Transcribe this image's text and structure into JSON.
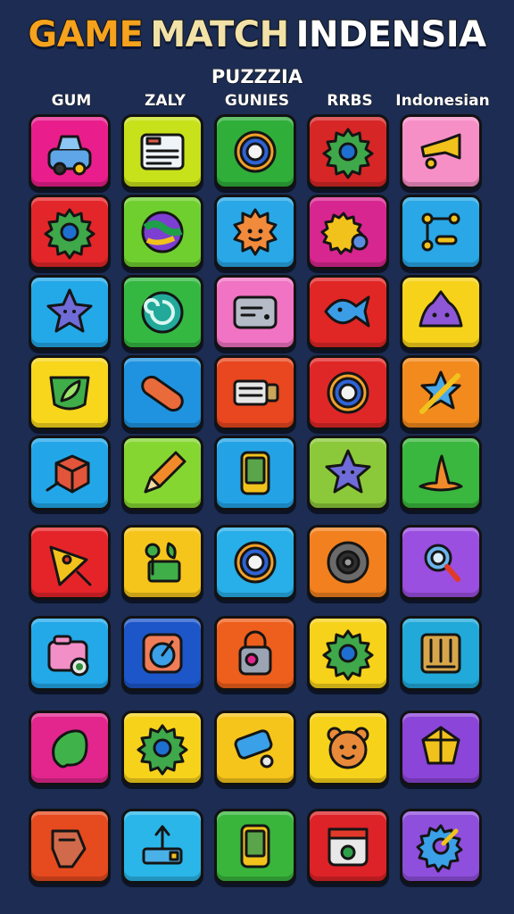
{
  "title": {
    "part1": "GAME",
    "part2": "MATCH",
    "part3": "INDENSIA"
  },
  "subtitle": "PUZZZIA",
  "columns": [
    "GUM",
    "ZALY",
    "GUNIES",
    "RRBS",
    "Indonesian"
  ],
  "tiles": [
    [
      {
        "color": "#e91e8c",
        "icon": "car-icon"
      },
      {
        "color": "#c7e21a",
        "icon": "id-card-icon"
      },
      {
        "color": "#2fae3a",
        "icon": "ring-icon"
      },
      {
        "color": "#d62626",
        "icon": "gear-icon"
      },
      {
        "color": "#f78fc7",
        "icon": "trumpet-icon"
      }
    ],
    [
      {
        "color": "#e3262a",
        "icon": "gear-icon"
      },
      {
        "color": "#6fcf2f",
        "icon": "planet-icon"
      },
      {
        "color": "#29a7e6",
        "icon": "sun-creature-icon"
      },
      {
        "color": "#d7268f",
        "icon": "gear-key-icon"
      },
      {
        "color": "#29a7e6",
        "icon": "circuit-icon"
      }
    ],
    [
      {
        "color": "#23a8e8",
        "icon": "star-icon"
      },
      {
        "color": "#35b842",
        "icon": "swirl-icon"
      },
      {
        "color": "#f173c3",
        "icon": "card-icon"
      },
      {
        "color": "#e12626",
        "icon": "fish-icon"
      },
      {
        "color": "#f6d21a",
        "icon": "blob-icon"
      }
    ],
    [
      {
        "color": "#f7d61c",
        "icon": "shield-leaf-icon"
      },
      {
        "color": "#1f93e0",
        "icon": "capsule-icon"
      },
      {
        "color": "#e8471f",
        "icon": "roller-icon"
      },
      {
        "color": "#e02727",
        "icon": "ring-icon"
      },
      {
        "color": "#f28a1d",
        "icon": "sword-star-icon"
      }
    ],
    [
      {
        "color": "#22a6e8",
        "icon": "cube-icon"
      },
      {
        "color": "#86d632",
        "icon": "pencil-icon"
      },
      {
        "color": "#23a3e6",
        "icon": "phone-icon"
      },
      {
        "color": "#8cc93a",
        "icon": "star-icon"
      },
      {
        "color": "#3ab73e",
        "icon": "hat-icon"
      }
    ],
    [
      {
        "color": "#e5242a",
        "icon": "pizza-icon"
      },
      {
        "color": "#f6c51b",
        "icon": "branch-icon"
      },
      {
        "color": "#28aee8",
        "icon": "ring-icon"
      },
      {
        "color": "#f2801e",
        "icon": "speaker-icon"
      },
      {
        "color": "#9a4fe0",
        "icon": "magnifier-icon"
      }
    ],
    [
      {
        "color": "#23a8e8",
        "icon": "camera-icon"
      },
      {
        "color": "#1d56c9",
        "icon": "dial-icon"
      },
      {
        "color": "#ee5e1c",
        "icon": "lock-icon"
      },
      {
        "color": "#f6d21a",
        "icon": "gear-icon"
      },
      {
        "color": "#20a9d9",
        "icon": "crate-icon"
      }
    ],
    [
      {
        "color": "#e2268d",
        "icon": "bean-icon"
      },
      {
        "color": "#f6d21a",
        "icon": "gear-icon"
      },
      {
        "color": "#f6c51b",
        "icon": "eraser-icon"
      },
      {
        "color": "#f6d21a",
        "icon": "bear-icon"
      },
      {
        "color": "#8b45d8",
        "icon": "gem-icon"
      }
    ],
    [
      {
        "color": "#e64a1f",
        "icon": "scroll-icon"
      },
      {
        "color": "#2ab6e8",
        "icon": "arrow-box-icon"
      },
      {
        "color": "#39b53c",
        "icon": "phone-icon"
      },
      {
        "color": "#dd2328",
        "icon": "calendar-icon"
      },
      {
        "color": "#8e4fdc",
        "icon": "gear-brush-icon"
      }
    ]
  ]
}
